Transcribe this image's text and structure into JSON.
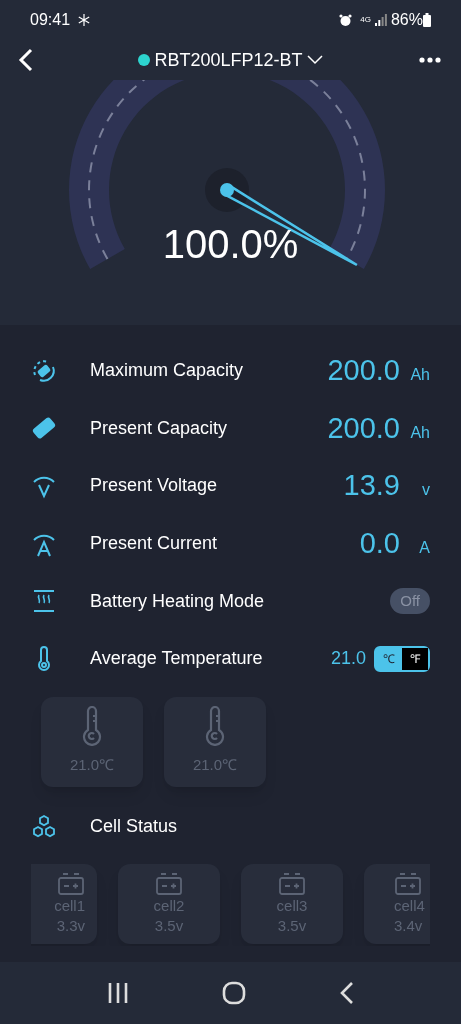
{
  "status_bar": {
    "time": "09:41",
    "network": "4G",
    "battery": "86%"
  },
  "header": {
    "device_name": "RBT200LFP12-BT",
    "connected": true
  },
  "gauge": {
    "reading": "100.0%"
  },
  "metrics": [
    {
      "kind": "value",
      "label": "Maximum Capacity",
      "value": "200.0",
      "unit": "Ah"
    },
    {
      "kind": "value",
      "label": "Present Capacity",
      "value": "200.0",
      "unit": "Ah"
    },
    {
      "kind": "value",
      "label": "Present Voltage",
      "value": "13.9",
      "unit": "v"
    },
    {
      "kind": "value",
      "label": "Present Current",
      "value": "0.0",
      "unit": "A"
    },
    {
      "kind": "switch",
      "label": "Battery Heating Mode",
      "switch_label": "Off",
      "on": false
    },
    {
      "kind": "temperature",
      "label": "Average Temperature",
      "value": "21.0",
      "units": [
        {
          "label": "℃",
          "selected": true
        },
        {
          "label": "℉",
          "selected": false
        }
      ]
    }
  ],
  "sensors": [
    {
      "reading": "21.0℃"
    },
    {
      "reading": "21.0℃"
    }
  ],
  "cell_status": {
    "title": "Cell Status",
    "cells": [
      {
        "name": "cell1",
        "voltage": "3.3v"
      },
      {
        "name": "cell2",
        "voltage": "3.5v"
      },
      {
        "name": "cell3",
        "voltage": "3.5v"
      },
      {
        "name": "cell4",
        "voltage": "3.4v"
      }
    ]
  }
}
